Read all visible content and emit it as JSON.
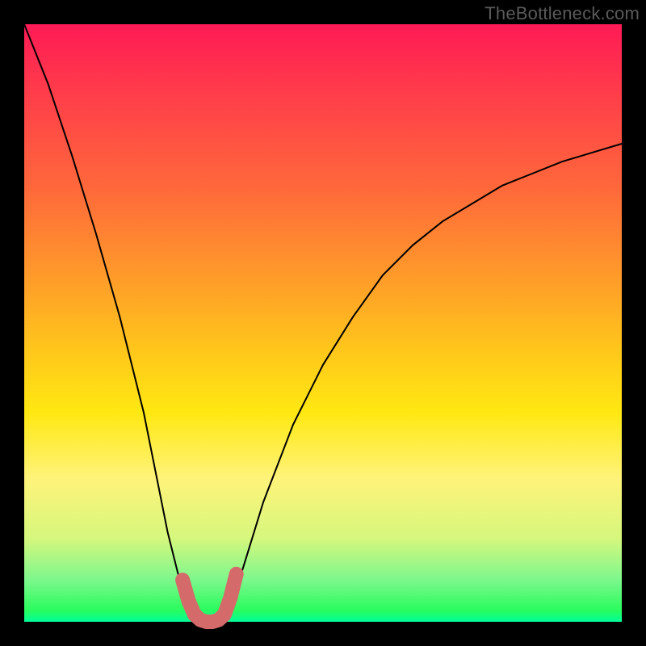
{
  "watermark": "TheBottleneck.com",
  "chart_data": {
    "type": "line",
    "title": "",
    "xlabel": "",
    "ylabel": "",
    "xlim": [
      0,
      100
    ],
    "ylim": [
      0,
      100
    ],
    "series": [
      {
        "name": "bottleneck-curve",
        "x": [
          0,
          4,
          8,
          12,
          16,
          20,
          24,
          26,
          28,
          29,
          30,
          31,
          32,
          33,
          34,
          36,
          40,
          45,
          50,
          55,
          60,
          65,
          70,
          75,
          80,
          85,
          90,
          95,
          100
        ],
        "y": [
          100,
          90,
          78,
          65,
          51,
          35,
          15,
          7,
          2,
          0.5,
          0,
          0,
          0,
          0.5,
          2,
          7,
          20,
          33,
          43,
          51,
          58,
          63,
          67,
          70,
          73,
          75,
          77,
          78.5,
          80
        ]
      }
    ],
    "highlight": {
      "name": "trough-highlight",
      "color": "#d46a6a",
      "x": [
        26.5,
        27.5,
        28.5,
        29.5,
        30.5,
        31.5,
        32.5,
        33.5,
        34.5,
        35.5
      ],
      "y": [
        7,
        3.5,
        1.2,
        0.3,
        0,
        0,
        0.3,
        1.2,
        4,
        8
      ]
    }
  }
}
